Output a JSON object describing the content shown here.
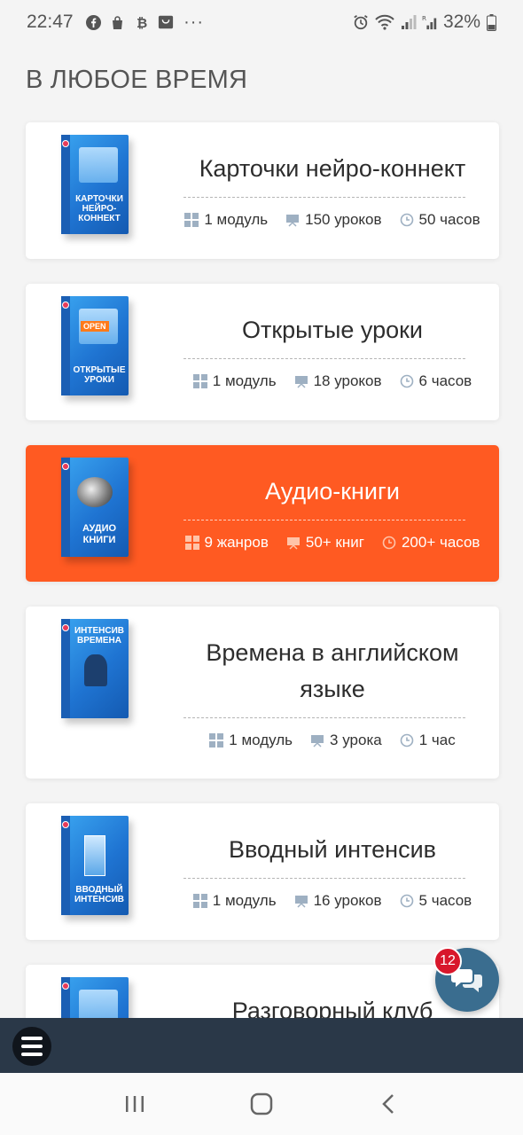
{
  "status_bar": {
    "time": "22:47",
    "battery": "32%",
    "icons": [
      "facebook-icon",
      "shopping-bag-icon",
      "bitcoin-icon",
      "store-icon",
      "more-dots-icon",
      "alarm-icon",
      "wifi-icon",
      "signal-icon",
      "signal-roaming-icon",
      "battery-icon"
    ],
    "dots": "···"
  },
  "section_title": "В ЛЮБОЕ ВРЕМЯ",
  "cards": [
    {
      "title": "Карточки нейро-коннект",
      "box_label": "КАРТОЧКИ НЕЙРО-КОННЕКТ",
      "meta": [
        "1 модуль",
        "150 уроков",
        "50 часов"
      ]
    },
    {
      "title": "Открытые уроки",
      "box_label": "ОТКРЫТЫЕ УРОКИ",
      "box_tag": "OPEN",
      "meta": [
        "1 модуль",
        "18 уроков",
        "6 часов"
      ]
    },
    {
      "title": "Аудио-книги",
      "box_label": "АУДИО КНИГИ",
      "meta": [
        "9 жанров",
        "50+ книг",
        "200+ часов"
      ]
    },
    {
      "title": "Времена в английском языке",
      "box_label": "ИНТЕНСИВ ВРЕМЕНА",
      "meta": [
        "1 модуль",
        "3 урока",
        "1 час"
      ]
    },
    {
      "title": "Вводный интенсив",
      "box_label": "ВВОДНЫЙ ИНТЕНСИВ",
      "meta": [
        "1 модуль",
        "16 уроков",
        "5 часов"
      ]
    },
    {
      "title": "Разговорный клуб"
    }
  ],
  "chat": {
    "badge": "12",
    "icon": "chat-bubbles-icon"
  },
  "bottom_bar": {
    "icon": "hamburger-menu-icon"
  },
  "nav": {
    "recents_icon": "recents-icon",
    "home_icon": "home-icon",
    "back_icon": "back-icon"
  },
  "colors": {
    "accent": "#ff5a22",
    "box_blue": "#1f74d2",
    "bottom_bar": "#2a3848",
    "chat": "#3a6d8f",
    "badge": "#d8172b"
  }
}
